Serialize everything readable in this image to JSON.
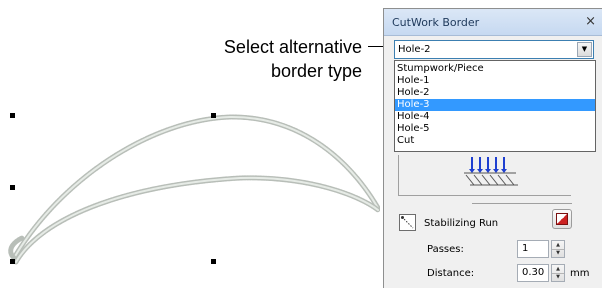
{
  "callout": {
    "line1": "Select alternative",
    "line2": "border type"
  },
  "panel": {
    "title": "CutWork Border",
    "close_glyph": "×",
    "border_select": {
      "value": "Hole-2",
      "arrow_glyph": "▼"
    },
    "dropdown": {
      "options": [
        "Stumpwork/Piece",
        "Hole-1",
        "Hole-2",
        "Hole-3",
        "Hole-4",
        "Hole-5",
        "Cut"
      ],
      "highlighted": "Hole-3"
    },
    "stabilizing": {
      "label": "Stabilizing Run"
    },
    "passes": {
      "label": "Passes:",
      "value": "1"
    },
    "distance": {
      "label": "Distance:",
      "value": "0.30",
      "unit": "mm"
    },
    "spin_up_glyph": "▲",
    "spin_down_glyph": "▼"
  },
  "colors": {
    "highlight": "#3399ff",
    "titlebar": "#c6d9f1",
    "stitch": "#a8b0a8",
    "needle": "#1e3fd0"
  },
  "icons": [
    "close-icon",
    "dropdown-arrow-icon",
    "stabilizing-run-icon",
    "stitch-preview-icon",
    "spin-up-icon",
    "spin-down-icon"
  ]
}
